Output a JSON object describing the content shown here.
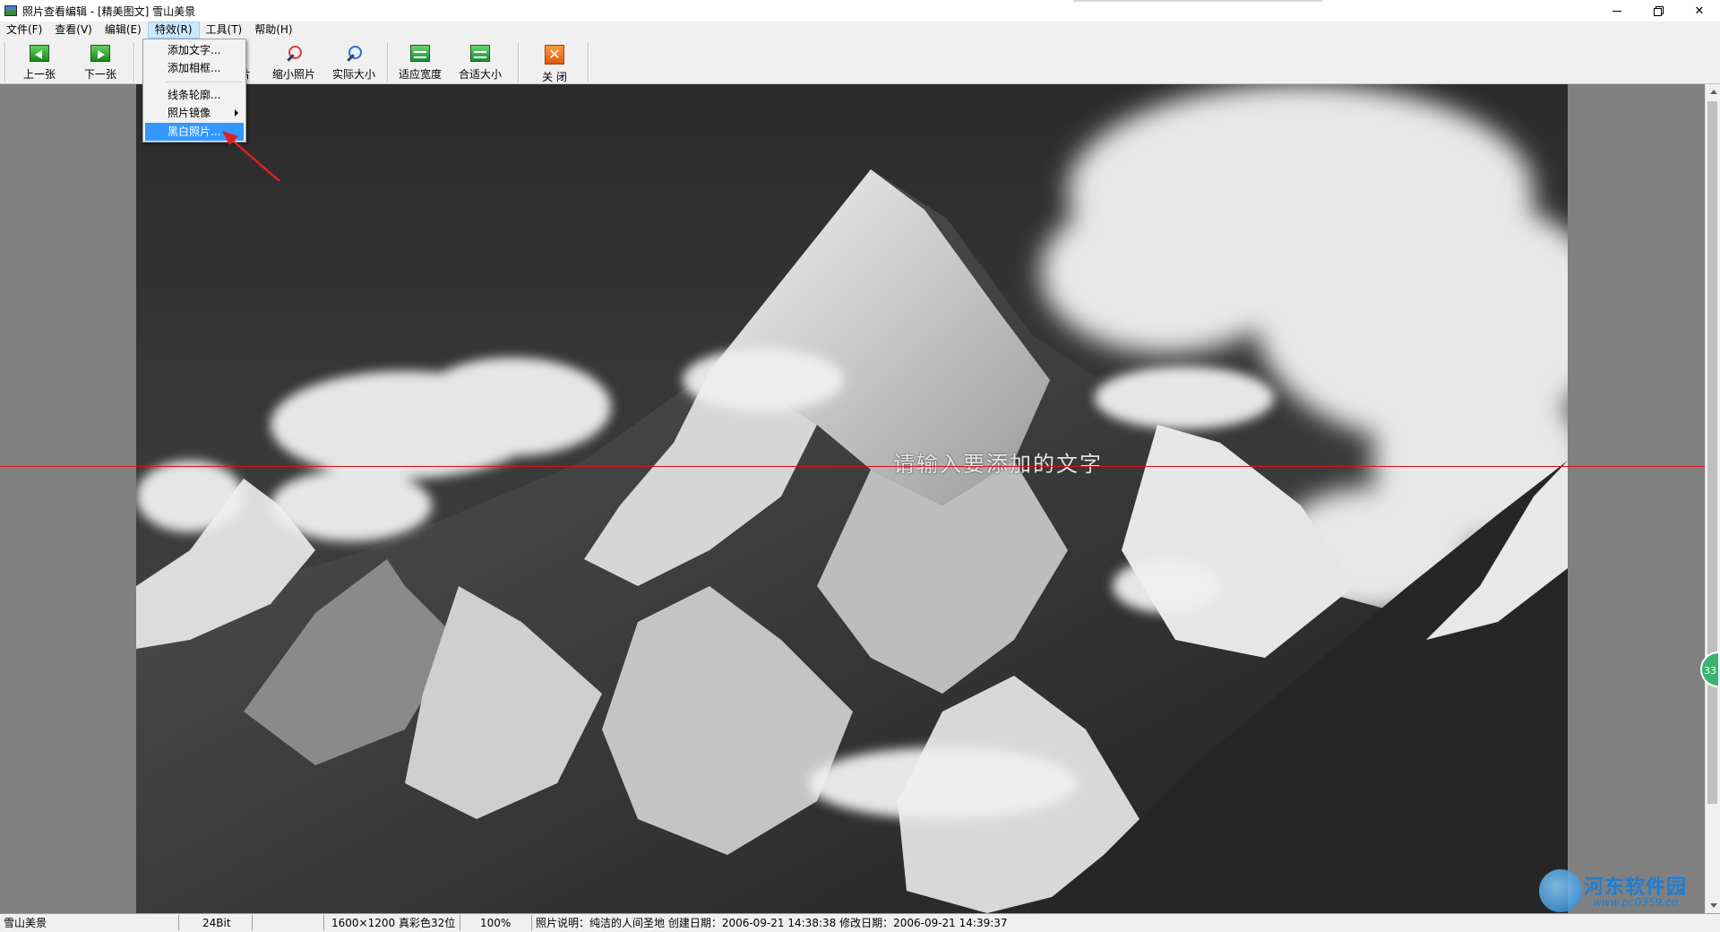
{
  "window": {
    "title": "照片查看编辑 - [精美图文] 雪山美景"
  },
  "menu": {
    "items": [
      {
        "label": "文件(F)"
      },
      {
        "label": "查看(V)"
      },
      {
        "label": "编辑(E)"
      },
      {
        "label": "特效(R)",
        "active": true
      },
      {
        "label": "工具(T)"
      },
      {
        "label": "帮助(H)"
      }
    ]
  },
  "toolbar": {
    "prev_label": "上一张",
    "next_label": "下一张",
    "hidden_label_fragment": "片",
    "zoom_out_label": "缩小照片",
    "actual_size_label": "实际大小",
    "fit_width_label": "适应宽度",
    "fit_size_label": "合适大小",
    "close_label": "关  闭"
  },
  "dropdown": {
    "items": [
      {
        "label": "添加文字..."
      },
      {
        "label": "添加相框..."
      },
      {
        "label": "线条轮廓..."
      },
      {
        "label": "照片镜像",
        "submenu": true
      },
      {
        "label": "黑白照片...",
        "highlighted": true
      }
    ]
  },
  "photo": {
    "overlay_text": "请输入要添加的文字"
  },
  "badge": {
    "text": "33"
  },
  "status": {
    "name": "雪山美景",
    "bitdepth": "24Bit",
    "dimensions": "1600×1200 真彩色32位",
    "zoom": "100%",
    "info": "照片说明：纯洁的人间圣地 创建日期：2006-09-21 14:38:38 修改日期：2006-09-21 14:39:37"
  },
  "watermark": {
    "title": "河东软件园",
    "url": "www.pc0359.cn"
  },
  "colors": {
    "accent": "#3399ff",
    "menu_active": "#cce8ff",
    "guide_line": "#e01010"
  }
}
